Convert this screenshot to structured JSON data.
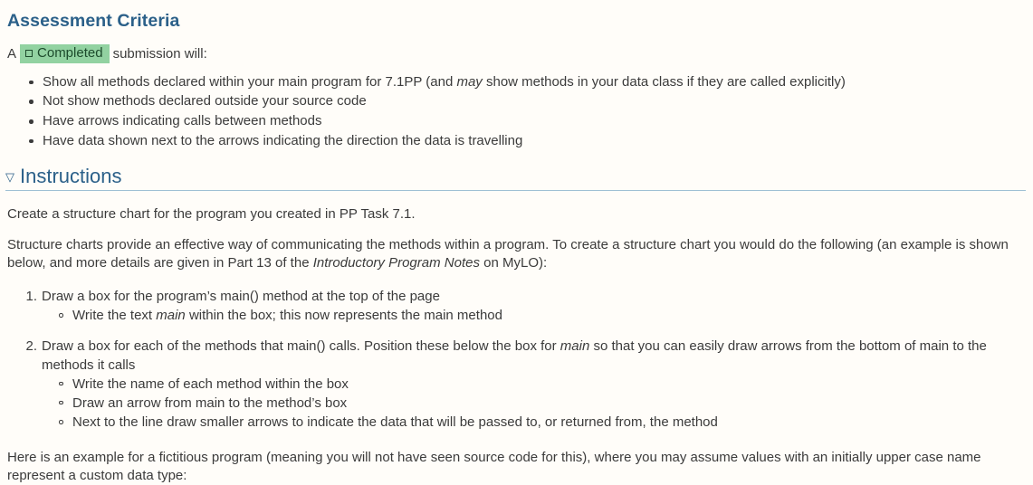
{
  "document": {
    "accent_color": "#2b6089",
    "text_color": "#3b3b3b",
    "background_color": "#fffdf9",
    "badge_background": "#92d2a1",
    "badge_text_color": "#1d4b2c",
    "rule_color": "#9fc0d4"
  },
  "assessment": {
    "heading": "Assessment Criteria",
    "lead_prefix": "A",
    "badge_label": "Completed",
    "badge_icon": "checkbox-square-icon",
    "lead_suffix": "submission will:",
    "criteria": [
      {
        "part1": "Show all methods declared within your main program for 7.1PP (and ",
        "italic": "may",
        "part2": " show methods in your data class if they are called explicitly)"
      },
      {
        "part1": "Not show methods declared outside your source code",
        "italic": "",
        "part2": ""
      },
      {
        "part1": "Have arrows indicating calls between methods",
        "italic": "",
        "part2": ""
      },
      {
        "part1": "Have data shown next to the arrows indicating the direction the data is travelling",
        "italic": "",
        "part2": ""
      }
    ]
  },
  "instructions": {
    "toggle_icon": "triangle-down-icon",
    "toggle_glyph": "▽",
    "heading": "Instructions",
    "intro_paragraph": "Create a structure chart for the program you created in PP Task 7.1.",
    "overview": {
      "part1": "Structure charts provide an effective way of communicating the methods within a program. To create a structure chart you would do the following (an example is shown below, and more details are given in Part 13 of the ",
      "italic": "Introductory Program Notes",
      "part2": " on MyLO):"
    },
    "steps": [
      {
        "main": {
          "part1": "Draw a box for the program’s main() method at the top of the page",
          "italic": "",
          "part2": ""
        },
        "subitems": [
          {
            "part1": "Write the text ",
            "italic": "main",
            "part2": " within the box; this now represents the main method"
          }
        ]
      },
      {
        "main": {
          "part1": "Draw a box for each of the methods that main() calls. Position these below the box for ",
          "italic": "main",
          "part2": " so that you can easily draw arrows from the bottom of main to the methods it calls"
        },
        "subitems": [
          {
            "part1": "Write the name of each method within the box",
            "italic": "",
            "part2": ""
          },
          {
            "part1": "Draw an arrow from main to the method’s box",
            "italic": "",
            "part2": ""
          },
          {
            "part1": "Next to the line draw smaller arrows to indicate the data that will be passed to, or returned from, the method",
            "italic": "",
            "part2": ""
          }
        ]
      }
    ],
    "closing_paragraph": "Here is an example for a fictitious program (meaning you will not have seen source code for this), where you may assume values with an initially upper case name represent a custom data type:"
  }
}
